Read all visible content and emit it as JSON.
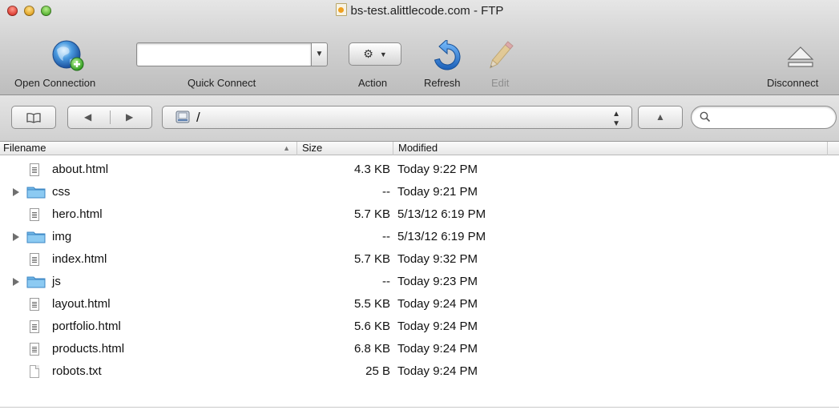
{
  "window": {
    "title": "bs-test.alittlecode.com - FTP"
  },
  "toolbar": {
    "open_connection": "Open Connection",
    "quick_connect": "Quick Connect",
    "quick_connect_value": "",
    "action": "Action",
    "refresh": "Refresh",
    "edit": "Edit",
    "disconnect": "Disconnect"
  },
  "pathbar": {
    "current_path": "/",
    "search_value": ""
  },
  "table": {
    "columns": {
      "filename": "Filename",
      "size": "Size",
      "modified": "Modified"
    },
    "rows": [
      {
        "name": "about.html",
        "size": "4.3 KB",
        "modified": "Today 9:22 PM",
        "kind": "html"
      },
      {
        "name": "css",
        "size": "--",
        "modified": "Today 9:21 PM",
        "kind": "folder"
      },
      {
        "name": "hero.html",
        "size": "5.7 KB",
        "modified": "5/13/12 6:19 PM",
        "kind": "html"
      },
      {
        "name": "img",
        "size": "--",
        "modified": "5/13/12 6:19 PM",
        "kind": "folder"
      },
      {
        "name": "index.html",
        "size": "5.7 KB",
        "modified": "Today 9:32 PM",
        "kind": "html"
      },
      {
        "name": "js",
        "size": "--",
        "modified": "Today 9:23 PM",
        "kind": "folder"
      },
      {
        "name": "layout.html",
        "size": "5.5 KB",
        "modified": "Today 9:24 PM",
        "kind": "html"
      },
      {
        "name": "portfolio.html",
        "size": "5.6 KB",
        "modified": "Today 9:24 PM",
        "kind": "html"
      },
      {
        "name": "products.html",
        "size": "6.8 KB",
        "modified": "Today 9:24 PM",
        "kind": "html"
      },
      {
        "name": "robots.txt",
        "size": "25 B",
        "modified": "Today 9:24 PM",
        "kind": "text"
      }
    ]
  },
  "colors": {
    "folder": "#6fb6e6",
    "refresh_blue": "#2a7fd6",
    "disabled_text": "#8e8e8e"
  }
}
